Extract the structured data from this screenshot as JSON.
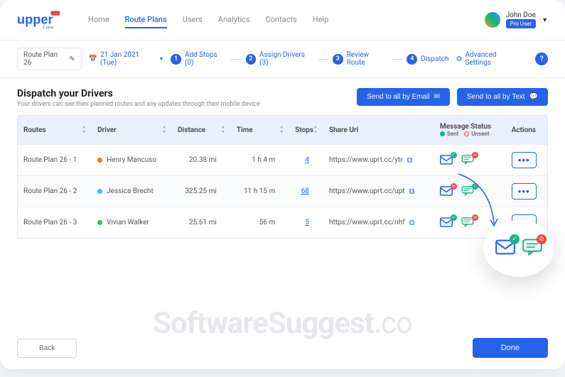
{
  "brand": {
    "name": "upper",
    "suffix": "Crew"
  },
  "nav": {
    "items": [
      "Home",
      "Route Plans",
      "Users",
      "Analytics",
      "Contacts",
      "Help"
    ],
    "active": "Route Plans"
  },
  "user": {
    "name": "John Doe",
    "tier": "Pro User"
  },
  "toolbar": {
    "plan": "Route Plan 26",
    "date": "21 Jan 2021 (Tue)",
    "steps": [
      {
        "n": "1",
        "label": "Add Stops (0)"
      },
      {
        "n": "2",
        "label": "Assign Drivers (3)"
      },
      {
        "n": "3",
        "label": "Review Route"
      },
      {
        "n": "4",
        "label": "Dispatch"
      }
    ],
    "advanced": "Advanced Settings"
  },
  "title": "Dispatch your Drivers",
  "subtitle": "Your drivers can see their planned routes and any updates through their mobile device",
  "buttons": {
    "send_email": "Send to all by Email",
    "send_text": "Send to all by Text",
    "back": "Back",
    "done": "Done"
  },
  "table": {
    "headers": [
      "Routes",
      "Driver",
      "Distance",
      "Time",
      "Stops",
      "Share Url",
      "Message Status",
      "Actions"
    ],
    "legend": {
      "sent": "Sent",
      "unsent": "Unsent"
    },
    "rows": [
      {
        "route": "Route Plan 26 - 1",
        "driver": "Henry Mancuso",
        "color": "#f97316",
        "distance": "20.38 mi",
        "time": "1 h 4 m",
        "stops": "4",
        "url": "https://www.uprt.cc/ytr",
        "email_sent": true,
        "text_sent": false
      },
      {
        "route": "Route Plan 26 - 2",
        "driver": "Jessica Brecht",
        "color": "#38bdf8",
        "distance": "325.25 mi",
        "time": "11 h 15 m",
        "stops": "68",
        "url": "https://www.uprt.cc/upt",
        "email_sent": false,
        "text_sent": true
      },
      {
        "route": "Route Plan 26 - 3",
        "driver": "Vivian Walker",
        "color": "#22c55e",
        "distance": "25.61 mi",
        "time": "56 m",
        "stops": "5",
        "url": "https://www.uprt.cc/nhf",
        "email_sent": true,
        "text_sent": false
      }
    ]
  },
  "watermark": {
    "main": "SoftwareSuggest",
    "suffix": ".co"
  }
}
